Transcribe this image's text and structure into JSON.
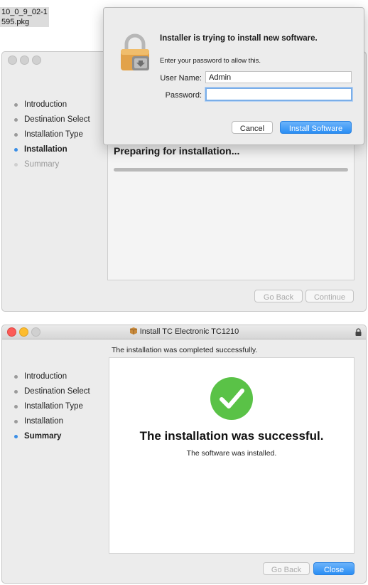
{
  "file_label": {
    "line1": "10_0_9_02-1",
    "line2": "595.pkg"
  },
  "installer_bg": {
    "steps": [
      {
        "label": "Introduction",
        "state": "done"
      },
      {
        "label": "Destination Select",
        "state": "done"
      },
      {
        "label": "Installation Type",
        "state": "done"
      },
      {
        "label": "Installation",
        "state": "active"
      },
      {
        "label": "Summary",
        "state": "dim"
      }
    ],
    "status_title": "Preparing for installation...",
    "buttons": {
      "back": "Go Back",
      "continue": "Continue"
    }
  },
  "auth_dialog": {
    "title": "Installer is trying to install new software.",
    "subtitle": "Enter your password to allow this.",
    "username_label": "User Name:",
    "username_value": "Admin",
    "password_label": "Password:",
    "password_value": "",
    "cancel_label": "Cancel",
    "install_label": "Install Software",
    "icon": "lock-icon"
  },
  "installer_done": {
    "window_title": "Install TC Electronic TC1210",
    "top_message": "The installation was completed successfully.",
    "steps": [
      {
        "label": "Introduction",
        "state": "done"
      },
      {
        "label": "Destination Select",
        "state": "done"
      },
      {
        "label": "Installation Type",
        "state": "done"
      },
      {
        "label": "Installation",
        "state": "done"
      },
      {
        "label": "Summary",
        "state": "active"
      }
    ],
    "success_title": "The installation was successful.",
    "success_subtitle": "The software was installed.",
    "buttons": {
      "back": "Go Back",
      "close": "Close"
    },
    "colors": {
      "success": "#5ac247",
      "close_action": "#2a8ef4"
    }
  }
}
